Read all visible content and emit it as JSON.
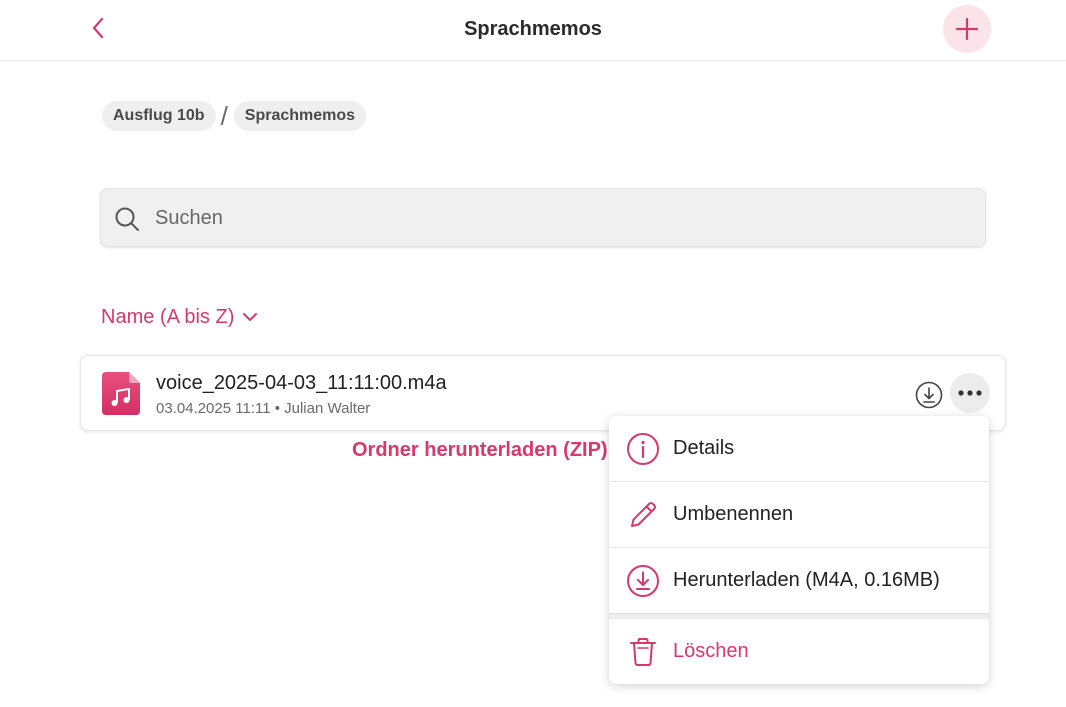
{
  "colors": {
    "accent": "#d6396c",
    "accent_light": "#fbe3ea",
    "text": "#222222",
    "muted": "#6a6a6a"
  },
  "header": {
    "title": "Sprachmemos",
    "back_icon": "chevron-left-icon",
    "add_icon": "plus-icon"
  },
  "breadcrumb": {
    "items": [
      {
        "label": "Ausflug 10b"
      },
      {
        "label": "Sprachmemos"
      }
    ],
    "separator": "/"
  },
  "search": {
    "placeholder": "Suchen",
    "value": ""
  },
  "sort": {
    "label": "Name (A bis Z)"
  },
  "files": [
    {
      "name": "voice_2025-04-03_11:11:00.m4a",
      "meta": "03.04.2025 11:11 • Julian Walter",
      "icon": "music-file-icon"
    }
  ],
  "folder_download": {
    "label": "Ordner herunterladen (ZIP)"
  },
  "context_menu": {
    "items": [
      {
        "label": "Details",
        "icon": "info-icon"
      },
      {
        "label": "Umbenennen",
        "icon": "pencil-icon"
      },
      {
        "label": "Herunterladen (M4A, 0.16MB)",
        "icon": "download-icon"
      },
      {
        "label": "Löschen",
        "icon": "trash-icon"
      }
    ]
  }
}
